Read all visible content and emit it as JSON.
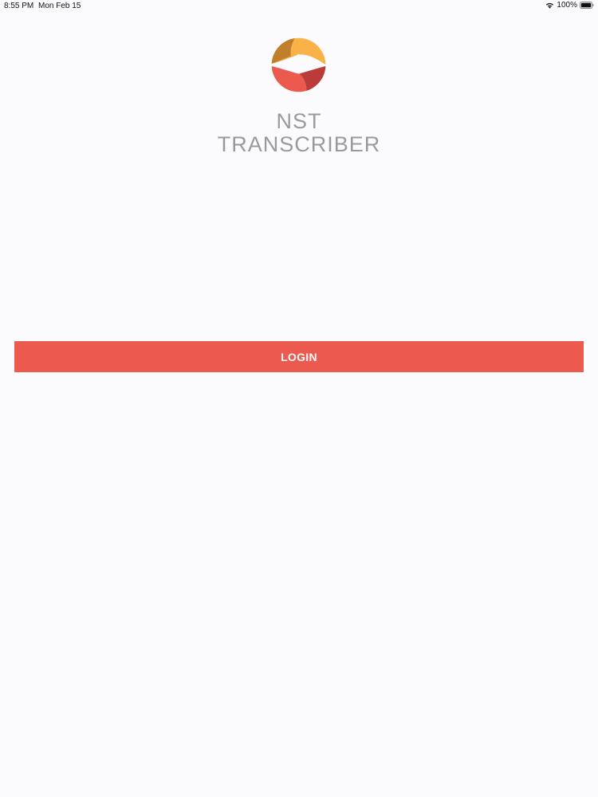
{
  "status_bar": {
    "time": "8:55 PM",
    "date": "Mon Feb 15",
    "battery": "100%",
    "icons": [
      "wifi-icon",
      "battery-icon"
    ]
  },
  "app": {
    "title_line1": "NST",
    "title_line2": "TRANSCRIBER",
    "logo": "nst-logo-icon"
  },
  "login": {
    "label": "LOGIN"
  },
  "colors": {
    "background": "#fbfafc",
    "accent": "#ec5a4f",
    "title_gray": "#9a9a9e",
    "logo_orange": "#f8b247",
    "logo_brown": "#c27f2b",
    "logo_red": "#ec5a4f",
    "logo_darkred": "#b93c38"
  }
}
